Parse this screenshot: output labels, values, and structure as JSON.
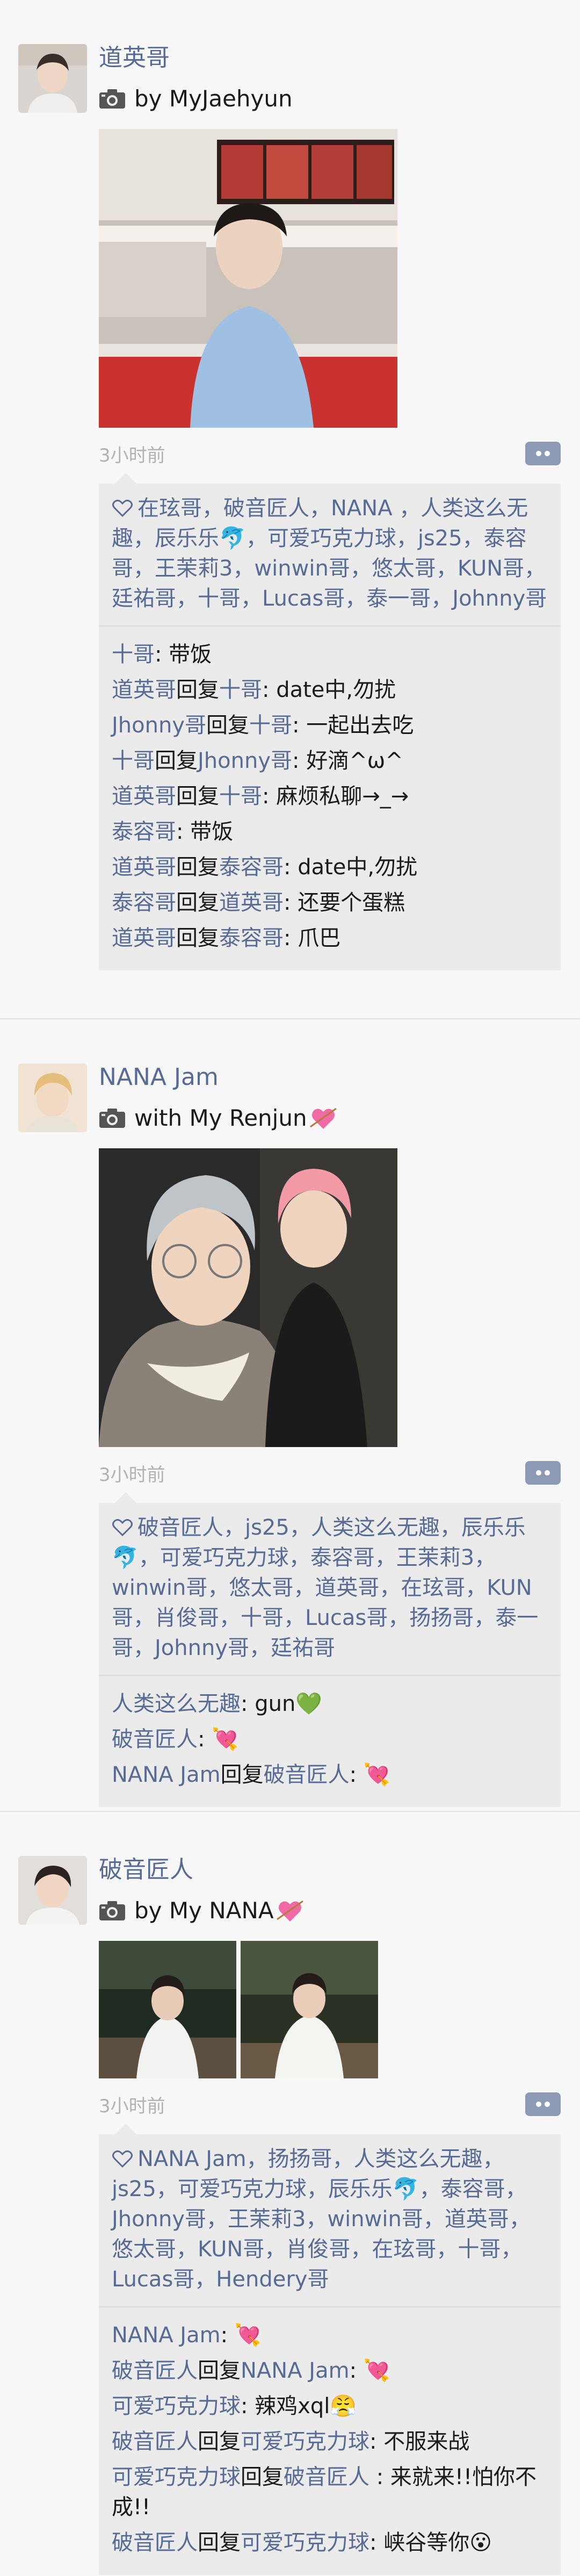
{
  "colors": {
    "link": "#576b95",
    "time": "#b2b2b2",
    "panel": "#ebebeb"
  },
  "posts": [
    {
      "name": "道英哥",
      "caption": "by MyJaehyun",
      "caption_emoji": "",
      "time": "3小时前",
      "likes": [
        "在玹哥",
        "破音匠人",
        "NANA ",
        "人类这么无趣",
        "辰乐乐🐬",
        "可爱巧克力球",
        "js25",
        "泰容哥",
        "王茉莉3",
        "winwin哥",
        "悠太哥",
        "KUN哥",
        "廷祐哥",
        "十哥",
        "Lucas哥",
        "泰一哥",
        "Johnny哥"
      ],
      "comments": [
        {
          "user": "十哥",
          "reply_word": "",
          "to": "",
          "text": "带饭"
        },
        {
          "user": "道英哥",
          "reply_word": "回复",
          "to": "十哥",
          "text": "date中,勿扰"
        },
        {
          "user": "Jhonny哥",
          "reply_word": "回复",
          "to": "十哥",
          "text": "一起出去吃"
        },
        {
          "user": "十哥",
          "reply_word": "回复",
          "to": "Jhonny哥",
          "text": "好滴^ω^"
        },
        {
          "user": "道英哥",
          "reply_word": "回复",
          "to": "十哥",
          "text": "麻烦私聊→_→"
        },
        {
          "user": "泰容哥",
          "reply_word": "",
          "to": "",
          "text": "带饭"
        },
        {
          "user": "道英哥",
          "reply_word": "回复",
          "to": "泰容哥",
          "text": "date中,勿扰"
        },
        {
          "user": "泰容哥",
          "reply_word": "回复",
          "to": "道英哥",
          "text": "还要个蛋糕"
        },
        {
          "user": "道英哥",
          "reply_word": "回复",
          "to": "泰容哥",
          "text": "爪巴"
        }
      ]
    },
    {
      "name": "NANA Jam",
      "caption": "with My Renjun",
      "time": "3小时前",
      "likes": [
        "破音匠人",
        "js25",
        "人类这么无趣",
        "辰乐乐🐬",
        "可爱巧克力球",
        "泰容哥",
        "王茉莉3",
        "winwin哥",
        "悠太哥",
        "道英哥",
        "在玹哥",
        "KUN哥",
        "肖俊哥",
        "十哥",
        "Lucas哥",
        "扬扬哥",
        "泰一哥",
        "Johnny哥",
        "廷祐哥"
      ],
      "comments": [
        {
          "user": "人类这么无趣",
          "reply_word": "",
          "to": "",
          "text": "gun💚"
        },
        {
          "user": "破音匠人",
          "reply_word": "",
          "to": "",
          "text": "💘"
        },
        {
          "user": "NANA Jam",
          "reply_word": "回复",
          "to": "破音匠人",
          "text": "💘"
        }
      ]
    },
    {
      "name": "破音匠人",
      "caption": "by My NANA",
      "time": "3小时前",
      "likes": [
        "NANA Jam",
        "扬扬哥",
        "人类这么无趣",
        "js25",
        "可爱巧克力球",
        "辰乐乐🐬",
        "泰容哥",
        "Jhonny哥",
        "王茉莉3",
        "winwin哥",
        "道英哥",
        "悠太哥",
        "KUN哥",
        "肖俊哥",
        "在玹哥",
        "十哥",
        "Lucas哥",
        "Hendery哥"
      ],
      "comments": [
        {
          "user": "NANA Jam",
          "reply_word": "",
          "to": "",
          "text": "💘"
        },
        {
          "user": "破音匠人",
          "reply_word": "回复",
          "to": "NANA Jam",
          "text": "💘"
        },
        {
          "user": "可爱巧克力球",
          "reply_word": "",
          "to": "",
          "text": "辣鸡xql😤"
        },
        {
          "user": "破音匠人",
          "reply_word": "回复",
          "to": "可爱巧克力球",
          "text": "不服来战"
        },
        {
          "user": "可爱巧克力球",
          "reply_word": "回复",
          "to": "破音匠人 ",
          "text": "来就来!!怕你不成!!"
        },
        {
          "user": "破音匠人",
          "reply_word": "回复",
          "to": "可爱巧克力球",
          "text": "峡谷等你😮"
        }
      ]
    }
  ],
  "icons": {
    "camera": "camera-icon",
    "like": "heart-outline-icon",
    "comment": "comment-dots-icon"
  }
}
